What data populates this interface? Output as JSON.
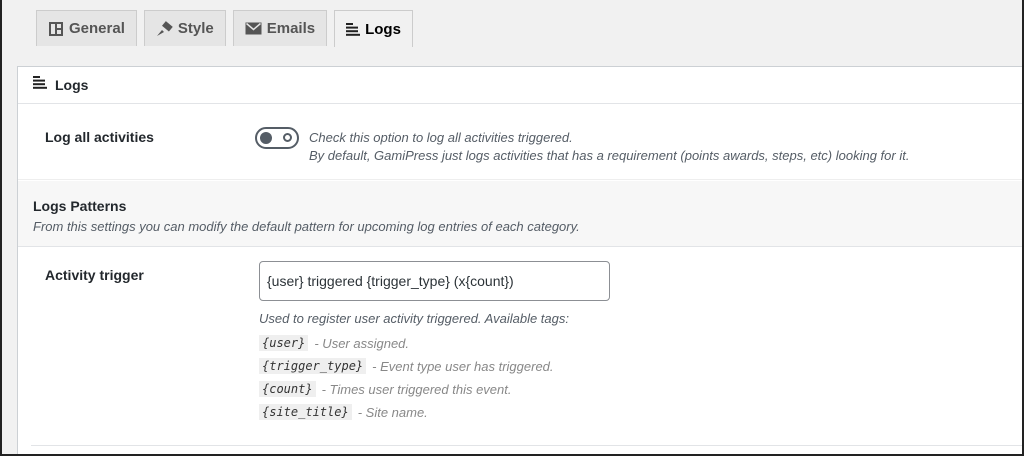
{
  "tabs": [
    {
      "label": "General",
      "icon": "layout-icon"
    },
    {
      "label": "Style",
      "icon": "brush-icon"
    },
    {
      "label": "Emails",
      "icon": "envelope-icon"
    },
    {
      "label": "Logs",
      "icon": "list-lines-icon",
      "active": true
    }
  ],
  "panel": {
    "title": "Logs",
    "log_all": {
      "label": "Log all activities",
      "enabled": false,
      "desc_line1": "Check this option to log all activities triggered.",
      "desc_line2": "By default, GamiPress just logs activities that has a requirement (points awards, steps, etc) looking for it."
    },
    "patterns": {
      "title": "Logs Patterns",
      "desc": "From this settings you can modify the default pattern for upcoming log entries of each category."
    },
    "activity_trigger": {
      "label": "Activity trigger",
      "value": "{user} triggered {trigger_type} (x{count})",
      "help": "Used to register user activity triggered. Available tags:",
      "tags": [
        {
          "code": "{user}",
          "desc": "- User assigned."
        },
        {
          "code": "{trigger_type}",
          "desc": "- Event type user has triggered."
        },
        {
          "code": "{count}",
          "desc": "- Times user triggered this event."
        },
        {
          "code": "{site_title}",
          "desc": "- Site name."
        }
      ]
    }
  }
}
